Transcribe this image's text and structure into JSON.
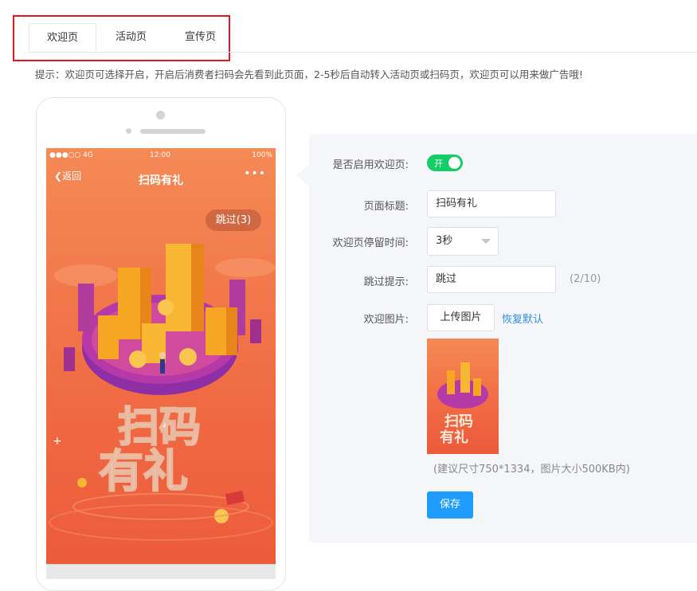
{
  "tabs": [
    {
      "label": "欢迎页",
      "active": true
    },
    {
      "label": "活动页",
      "active": false
    },
    {
      "label": "宣传页",
      "active": false
    }
  ],
  "tip": "提示：欢迎页可选择开启，开启后消费者扫码会先看到此页面，2-5秒后自动转入活动页或扫码页，欢迎页可以用来做广告哦!",
  "preview": {
    "status_carrier": "●●●○○ 4G",
    "status_time": "12:00",
    "status_battery": "100%",
    "back_label": "返回",
    "title": "扫码有礼",
    "more": "•••",
    "skip_label": "跳过(3)",
    "art_text_line1": "扫码",
    "art_text_line2": "有礼"
  },
  "form": {
    "enable_label": "是否启用欢迎页:",
    "enable_switch_text": "开",
    "enable_on": true,
    "title_label": "页面标题:",
    "title_value": "扫码有礼",
    "duration_label": "欢迎页停留时间:",
    "duration_value": "3秒",
    "skip_label": "跳过提示:",
    "skip_value": "跳过",
    "skip_counter": "(2/10)",
    "image_label": "欢迎图片:",
    "upload_button": "上传图片",
    "restore_link": "恢复默认",
    "size_hint": "(建议尺寸750*1334，图片大小500KB内)",
    "save_button": "保存"
  },
  "colors": {
    "accent_blue": "#1e9cff",
    "switch_green": "#13ce66",
    "highlight_red": "#e5141e",
    "link_blue": "#2f8ee0"
  }
}
